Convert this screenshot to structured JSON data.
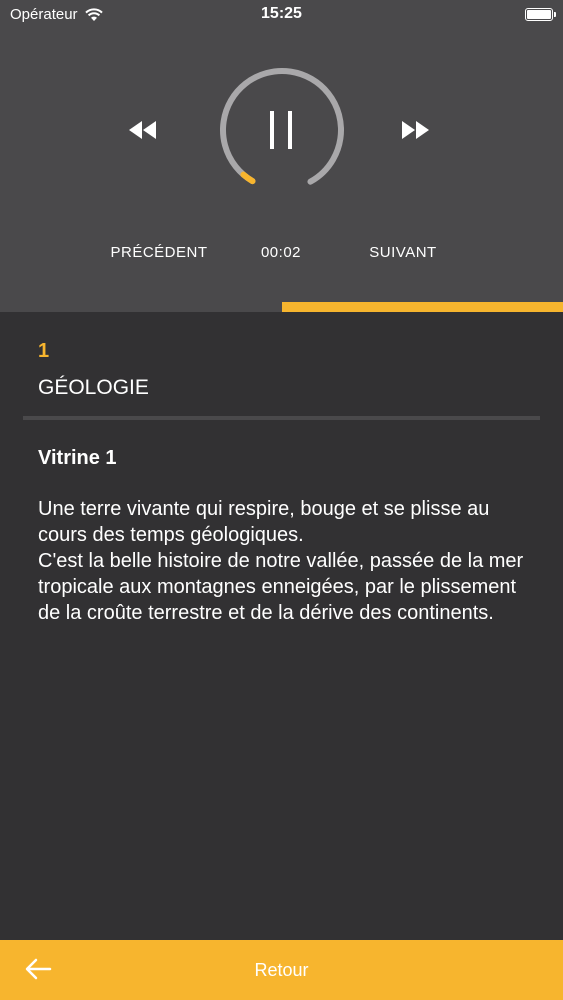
{
  "status_bar": {
    "carrier": "Opérateur",
    "time": "15:25"
  },
  "player": {
    "previous_label": "PRÉCÉDENT",
    "elapsed_time": "00:02",
    "next_label": "SUIVANT",
    "track_progress": 0.5,
    "ring_progress": 0.03,
    "accent_color": "#f7b52e"
  },
  "content": {
    "number": "1",
    "category": "GÉOLOGIE",
    "item_title": "Vitrine 1",
    "description": "Une terre vivante qui respire, bouge et se plisse au cours des temps géologiques.\nC'est la belle histoire de notre vallée, passée de la mer tropicale aux montagnes enneigées, par le plissement de la croûte terrestre et de la dérive des continents."
  },
  "footer": {
    "back_label": "Retour"
  }
}
